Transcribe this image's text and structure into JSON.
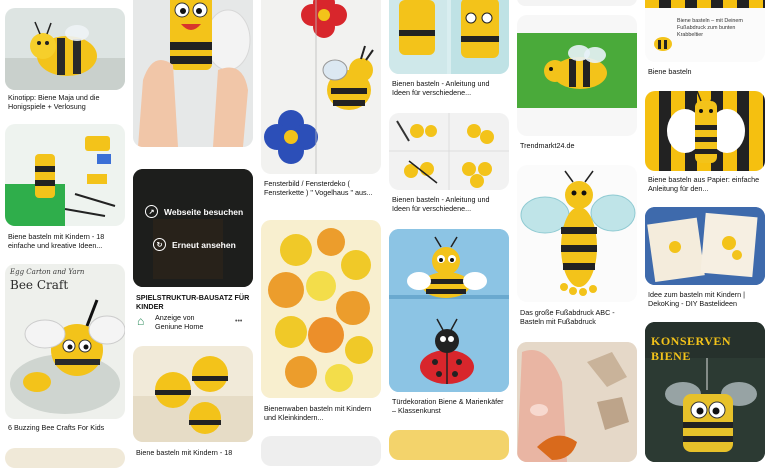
{
  "pins": {
    "kinotipp": {
      "caption": "Kinotipp: Biene Maja und die Honigspiele + Verlosung"
    },
    "roll_bee_top": {},
    "fensterbild": {
      "caption": "Fensterbild / Fensterdeko ( Fensterkette ) \" Vogelhaus \" aus..."
    },
    "bienen_basteln_1": {
      "caption": "Bienen basteln - Anleitung und Ideen für verschiedene..."
    },
    "trendmarkt": {
      "caption": "Trendmarkt24.de"
    },
    "biene_fussabdruck_top": {
      "caption": "Biene basteln",
      "banner_text": "Biene basteln – mit Deinem Fußabdruck zum bunten Krabbeltier"
    },
    "bienen_kinder_18": {
      "caption": "Biene basteln mit Kindern - 18 einfache und kreative Ideen..."
    },
    "sponsored": {
      "visit_label": "Webseite besuchen",
      "resend_label": "Erneut ansehen",
      "title": "SPIELSTRUKTUR-BAUSATZ FÜR KINDER",
      "ad_label": "Anzeige von",
      "advertiser": "Geniune Home",
      "more": "•••"
    },
    "bienen_basteln_2": {
      "caption": "Bienen basteln - Anleitung und Ideen für verschiedene..."
    },
    "papier_biene": {
      "caption": "Biene basteln aus Papier: einfache Anleitung für den..."
    },
    "fussabdruck_abc": {
      "caption": "Das große Fußabdruck ABC - Basteln mit Fußabdruck"
    },
    "dekoking": {
      "caption": "Idee zum basteln mit Kindern | DekoKing - DIY Bastelideen"
    },
    "egg_carton": {
      "overlay_1": "Egg Carton and Yarn",
      "overlay_2": "Bee Craft",
      "caption": "6 Buzzing Bee Crafts For Kids"
    },
    "bienenwaben": {
      "caption": "Bienenwaben basteln mit Kindern und Kleinkindern..."
    },
    "tuerdekoration": {
      "caption": "Türdekoration Biene & Marienkäfer – Klassenkunst"
    },
    "balloon_bees": {
      "caption": "Biene basteln mit Kindern - 18"
    },
    "konserven": {
      "overlay": "KONSERVEN BIENE"
    }
  },
  "colors": {
    "bee_yellow": "#f5c010",
    "black": "#1a1a1a",
    "ladybug_red": "#d8262c",
    "sky_blue": "#8ec6e6"
  }
}
